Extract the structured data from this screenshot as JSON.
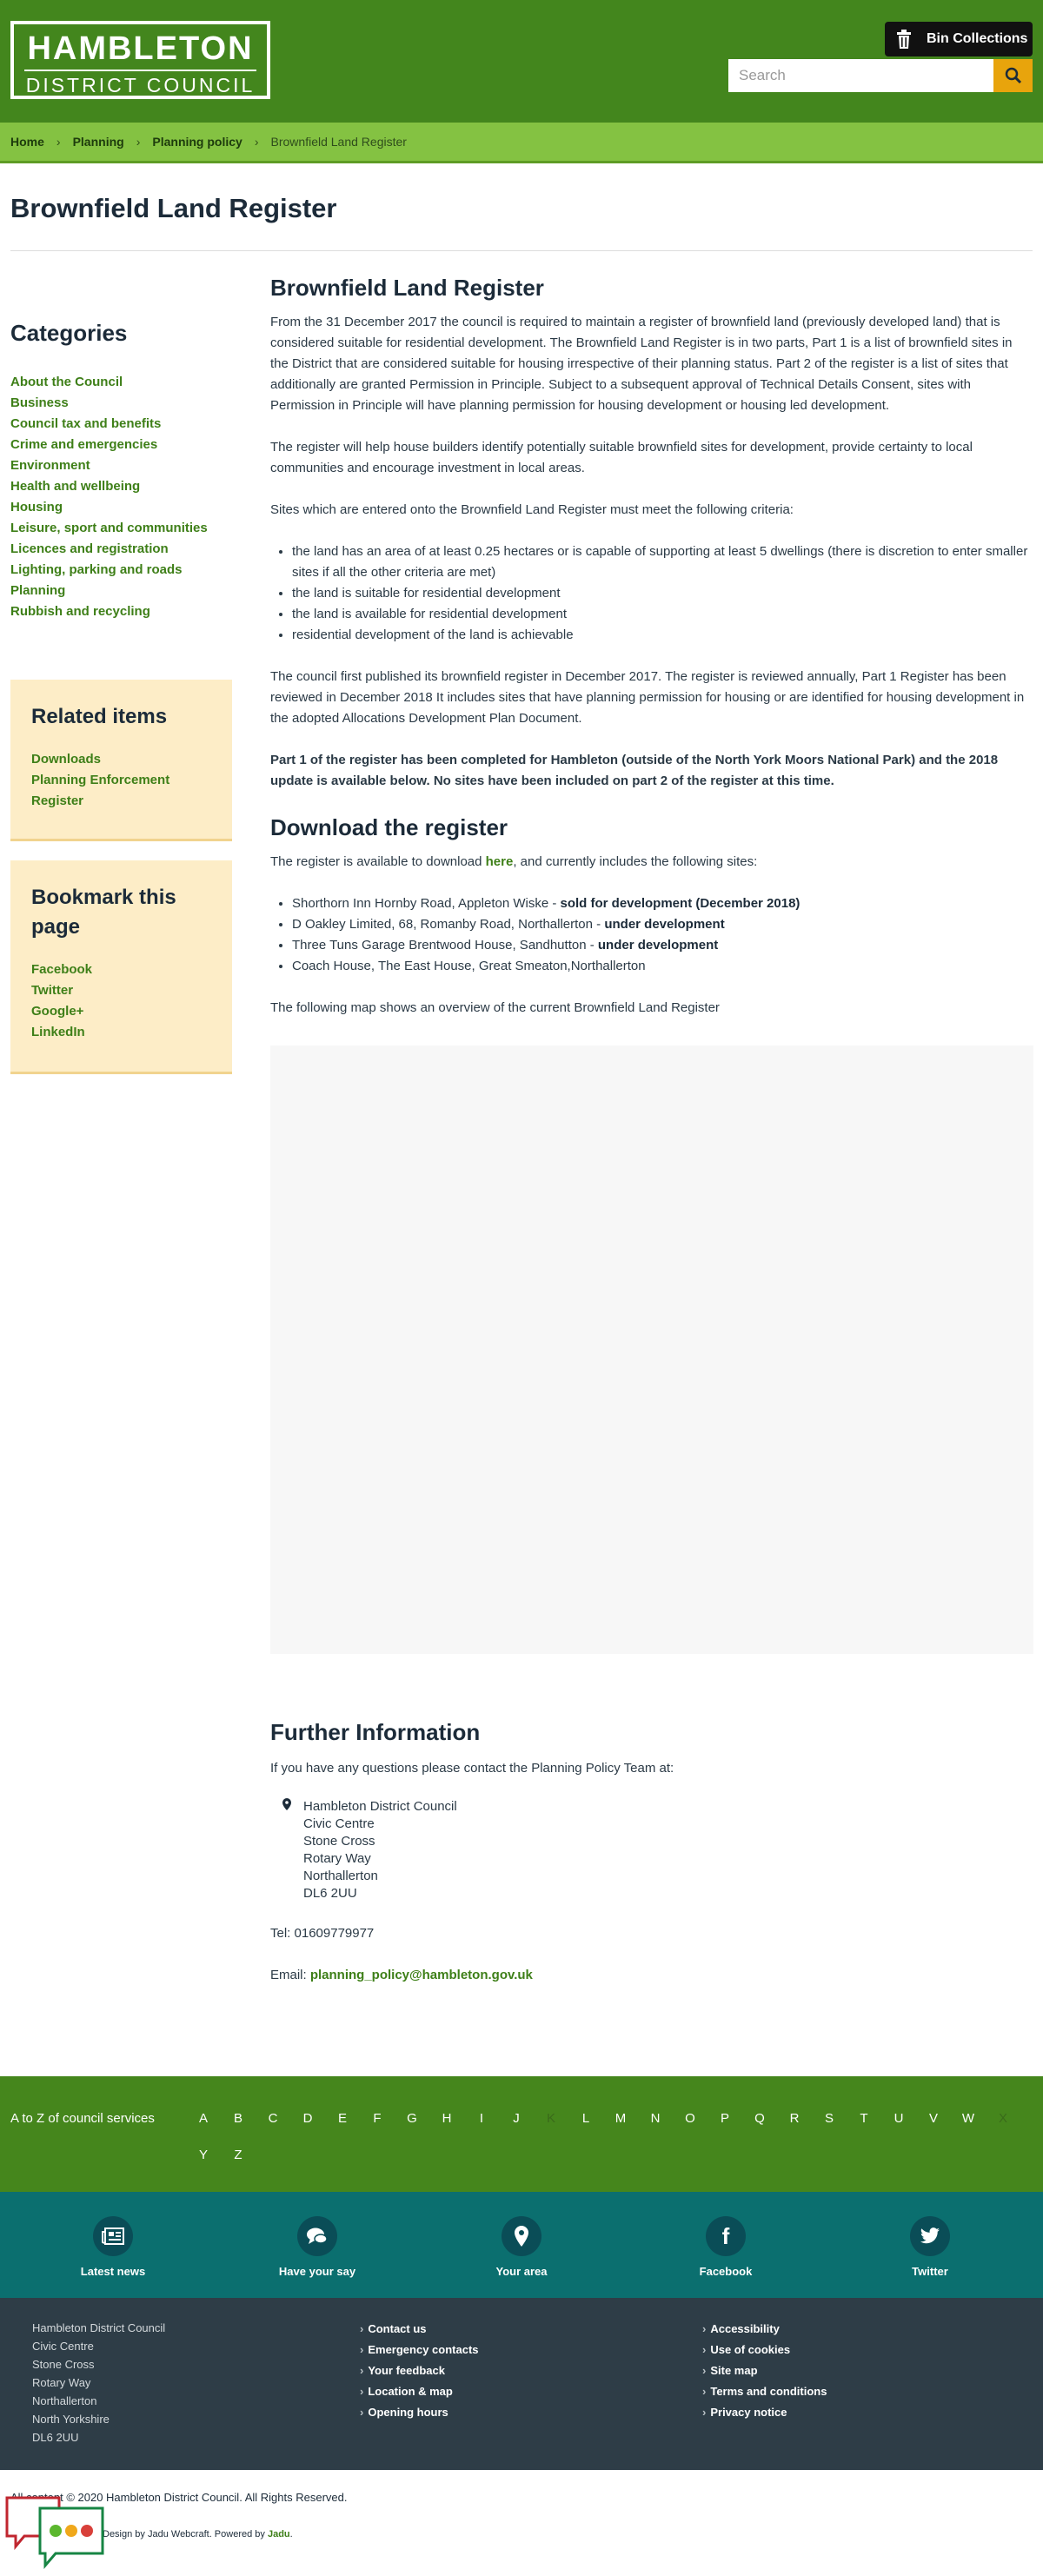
{
  "header": {
    "logo_line1": "HAMBLETON",
    "logo_line2": "DISTRICT COUNCIL",
    "bin_label": "Bin Collections",
    "search_placeholder": "Search"
  },
  "breadcrumb": {
    "items": [
      "Home",
      "Planning",
      "Planning policy"
    ],
    "current": "Brownfield Land Register"
  },
  "page_title": "Brownfield Land Register",
  "sidebar": {
    "categories_title": "Categories",
    "categories": [
      "About the Council",
      "Business",
      "Council tax and benefits",
      "Crime and emergencies",
      "Environment",
      "Health and wellbeing",
      "Housing",
      "Leisure, sport and communities",
      "Licences and registration",
      "Lighting, parking and roads",
      "Planning",
      "Rubbish and recycling"
    ],
    "related_title": "Related items",
    "related": [
      "Downloads",
      "Planning Enforcement Register"
    ],
    "bookmark_title": "Bookmark this page",
    "bookmark": [
      "Facebook",
      "Twitter",
      "Google+",
      "LinkedIn"
    ]
  },
  "main": {
    "heading": "Brownfield Land Register",
    "p1": "From the 31 December 2017 the council is required to maintain a register of brownfield land (previously developed land) that is considered suitable for residential development. The Brownfield Land Register is in two parts, Part 1 is a list of brownfield sites in the District that are considered suitable for housing irrespective of their planning status. Part 2 of the register is a list of sites that additionally are granted Permission in Principle. Subject to a subsequent approval of Technical Details Consent, sites with Permission in Principle will have planning permission for housing development or housing led development.",
    "p2": "The register will help house builders identify potentially suitable brownfield sites for development, provide certainty to local communities and encourage investment in local areas.",
    "p3": "Sites which are entered onto the Brownfield Land Register must meet the following criteria:",
    "criteria": [
      "the land has an area of at least 0.25 hectares or is capable of supporting at least 5 dwellings (there is discretion to enter smaller sites if all the other criteria are met)",
      "the land is suitable for residential development",
      "the land is available for residential development",
      "residential development of the land is achievable"
    ],
    "p4": "The council first published its brownfield register in December 2017. The register is reviewed annually, Part 1 Register has been reviewed in December 2018  It includes sites that have planning permission for housing or are identified for housing development in the adopted Allocations Development Plan Document.",
    "p5": "Part 1 of the register has been completed for Hambleton (outside of the North York Moors National Park) and the 2018 update is available below. No sites have been included on part 2 of the register at this time.",
    "download_heading": "Download the register",
    "download_pre": "The register is available to download ",
    "download_link": "here",
    "download_post": ", and currently includes the following sites:",
    "sites": [
      {
        "name": "Shorthorn Inn Hornby Road, Appleton Wiske - ",
        "status": "sold for development (December 2018)"
      },
      {
        "name": "D Oakley Limited, 68, Romanby Road, Northallerton - ",
        "status": "under development"
      },
      {
        "name": "Three Tuns Garage Brentwood House, Sandhutton - ",
        "status": "under development"
      },
      {
        "name": "Coach House, The East House, Great Smeaton,Northallerton",
        "status": ""
      }
    ],
    "map_intro": "The following map shows an overview of the current Brownfield Land Register",
    "further_heading": "Further Information",
    "further_intro": "If you have any questions please contact the Planning Policy Team at:",
    "address": [
      "Hambleton District Council",
      "Civic Centre",
      "Stone Cross",
      "Rotary Way",
      "Northallerton",
      "DL6 2UU"
    ],
    "tel": "Tel: 01609779977",
    "email_label": "Email: ",
    "email": "planning_policy@hambleton.gov.uk"
  },
  "az": {
    "label": "A to Z of council services",
    "letters": [
      "A",
      "B",
      "C",
      "D",
      "E",
      "F",
      "G",
      "H",
      "I",
      "J",
      "K",
      "L",
      "M",
      "N",
      "O",
      "P",
      "Q",
      "R",
      "S",
      "T",
      "U",
      "V",
      "W",
      "X",
      "Y",
      "Z"
    ],
    "disabled": [
      "K",
      "X"
    ]
  },
  "social": [
    {
      "label": "Latest news",
      "icon": "newspaper-icon"
    },
    {
      "label": "Have your say",
      "icon": "speech-bubbles-icon"
    },
    {
      "label": "Your area",
      "icon": "map-pin-icon"
    },
    {
      "label": "Facebook",
      "icon": "facebook-icon"
    },
    {
      "label": "Twitter",
      "icon": "twitter-icon"
    }
  ],
  "footer": {
    "address": [
      "Hambleton District Council",
      "Civic Centre",
      "Stone Cross",
      "Rotary Way",
      "Northallerton",
      "North Yorkshire",
      "DL6 2UU"
    ],
    "col2": [
      "Contact us",
      "Emergency contacts",
      "Your feedback",
      "Location & map",
      "Opening hours"
    ],
    "col3": [
      "Accessibility",
      "Use of cookies",
      "Site map",
      "Terms and conditions",
      "Privacy notice"
    ],
    "copyright": "All content © 2020 Hambleton District Council. All Rights Reserved.",
    "powered_pre": "Design by Jadu Webcraft. Powered by ",
    "powered_link": "Jadu",
    "powered_post": "."
  },
  "colors": {
    "brand_green": "#43861d",
    "link_green": "#3e7f18",
    "teal": "#0b6f6f",
    "footer": "#2e3d47",
    "accent_yellow": "#e8a40c"
  }
}
